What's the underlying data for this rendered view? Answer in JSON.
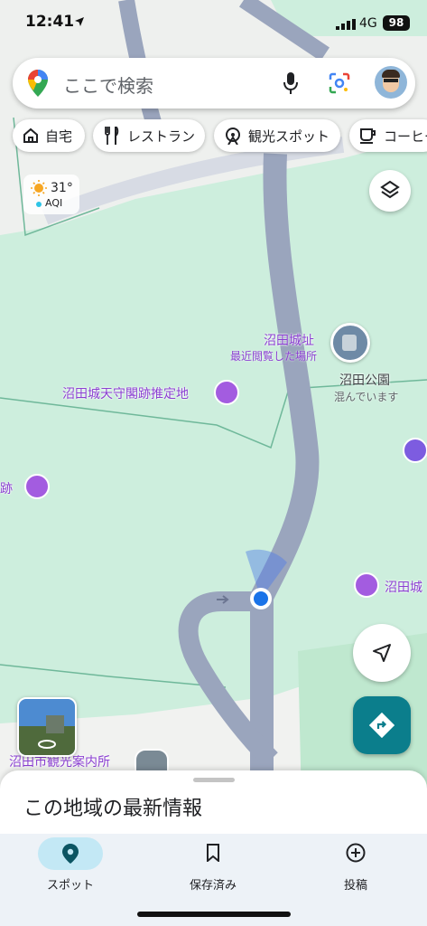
{
  "status_bar": {
    "time": "12:41",
    "network": "4G",
    "battery": "98"
  },
  "search": {
    "placeholder": "ここで検索"
  },
  "chips": [
    {
      "label": "自宅",
      "icon": "home-icon"
    },
    {
      "label": "レストラン",
      "icon": "restaurant-icon"
    },
    {
      "label": "観光スポット",
      "icon": "attraction-icon"
    },
    {
      "label": "コーヒー",
      "icon": "coffee-icon"
    }
  ],
  "weather": {
    "temperature": "31°",
    "aqi_label": "AQI"
  },
  "map_labels": {
    "castle_ruins": "沼田城址",
    "castle_ruins_sub": "最近閲覧した場所",
    "park": "沼田公園",
    "park_sub": "混んでいます",
    "keep_site": "沼田城天守閣跡推定地",
    "left_partial": "跡",
    "right_partial": "沼田城",
    "tourist_info": "沼田市観光案内所"
  },
  "sheet": {
    "title": "この地域の最新情報"
  },
  "nav": [
    {
      "label": "スポット",
      "icon": "explore-pin-icon",
      "active": true
    },
    {
      "label": "保存済み",
      "icon": "bookmark-icon",
      "active": false
    },
    {
      "label": "投稿",
      "icon": "add-circle-icon",
      "active": false
    }
  ],
  "colors": {
    "accent": "#0b7e8c",
    "poi": "#a35ce0",
    "location_dot": "#1a73e8",
    "map_green": "#cdeedd",
    "road": "#9aa5bd"
  }
}
